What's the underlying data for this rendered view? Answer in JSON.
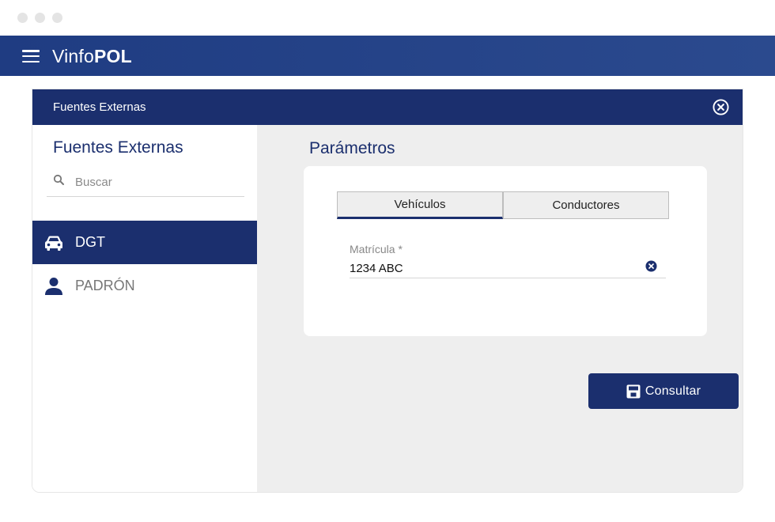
{
  "app": {
    "brand_prefix": "Vinfo",
    "brand_suffix": "POL"
  },
  "panel": {
    "header_title": "Fuentes Externas"
  },
  "sidebar": {
    "title": "Fuentes Externas",
    "search_placeholder": "Buscar",
    "items": [
      {
        "label": "DGT",
        "icon": "car-icon",
        "active": true
      },
      {
        "label": "PADRÓN",
        "icon": "person-icon",
        "active": false
      }
    ]
  },
  "content": {
    "title": "Parámetros",
    "tabs": [
      {
        "label": "Vehículos",
        "active": true
      },
      {
        "label": "Conductores",
        "active": false
      }
    ],
    "field": {
      "label": "Matrícula *",
      "value": "1234 ABC"
    },
    "submit_label": "Consultar"
  },
  "colors": {
    "primary": "#1b2f6e",
    "app_bar": "#2b4a8e",
    "content_bg": "#eeeeee"
  }
}
